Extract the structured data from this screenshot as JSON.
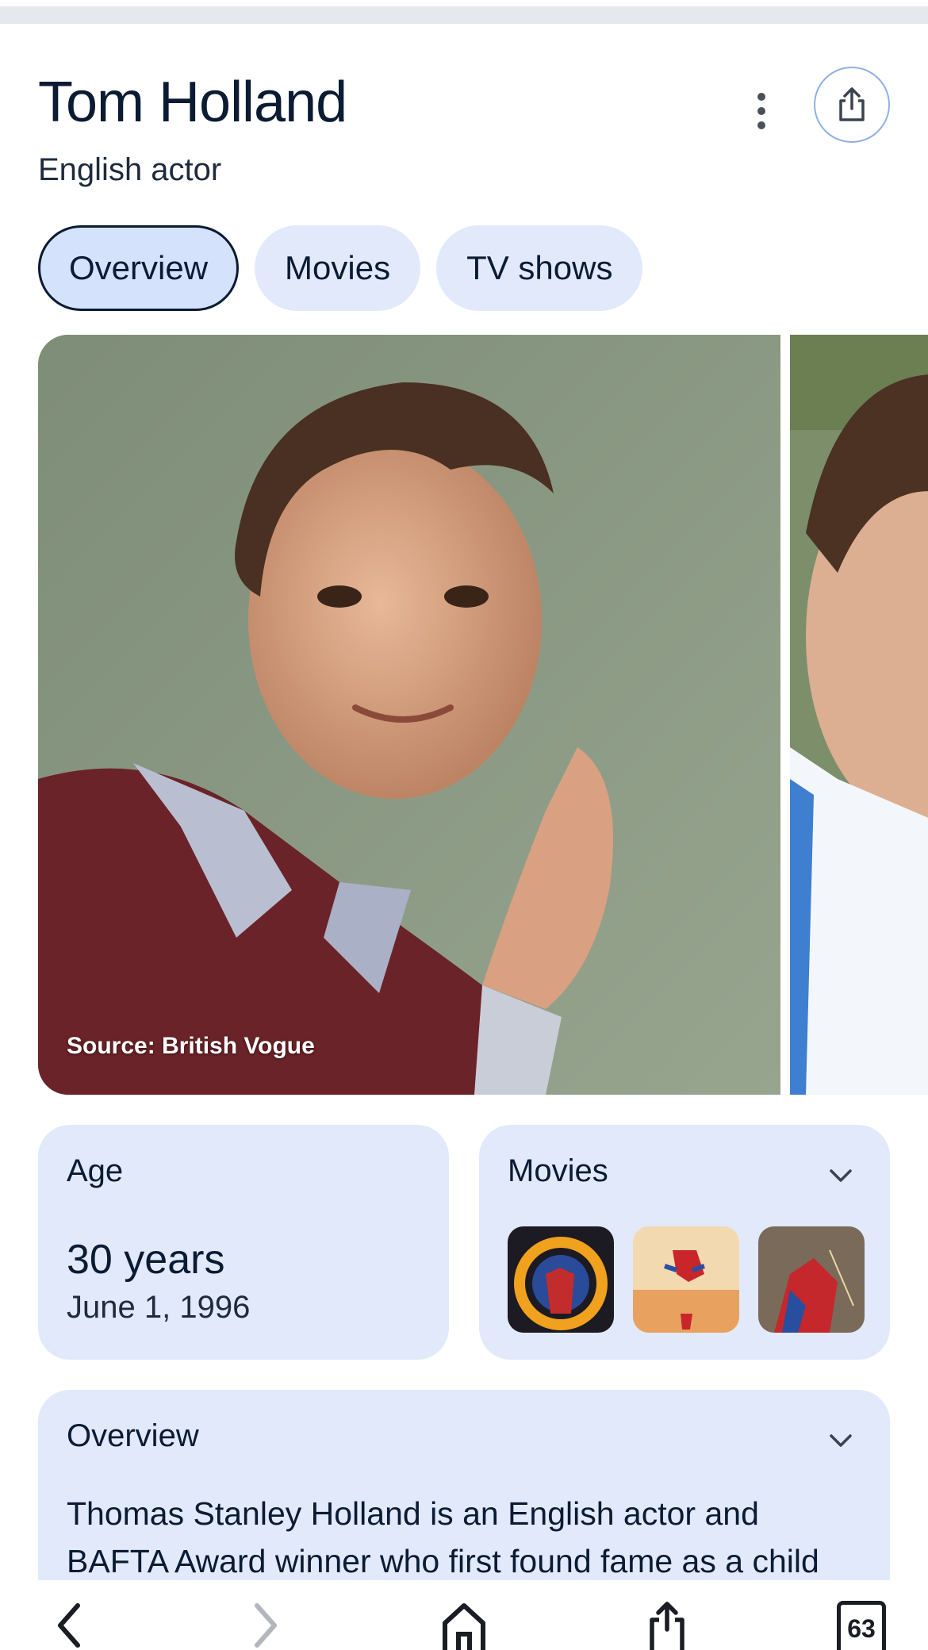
{
  "entity": {
    "name": "Tom Holland",
    "description": "English actor"
  },
  "tabs": [
    {
      "label": "Overview",
      "active": true
    },
    {
      "label": "Movies",
      "active": false
    },
    {
      "label": "TV shows",
      "active": false
    }
  ],
  "gallery": {
    "source": "Source: British Vogue"
  },
  "age_card": {
    "label": "Age",
    "value": "30 years",
    "birth_date": "June 1, 1996"
  },
  "movies_card": {
    "label": "Movies",
    "expand_icon": "chevron-down-icon"
  },
  "overview_card": {
    "label": "Overview",
    "text": "Thomas Stanley Holland is an English actor and BAFTA Award winner who first found fame as a child",
    "expand_icon": "chevron-down-icon"
  },
  "browser_bar": {
    "tab_count": "63",
    "icons": [
      "back-icon",
      "forward-icon",
      "home-icon",
      "share-icon",
      "tabs-icon"
    ]
  },
  "colors": {
    "card_bg": "#e1e9fb",
    "text": "#0b1b33",
    "accent_border": "#8fb0e3"
  }
}
